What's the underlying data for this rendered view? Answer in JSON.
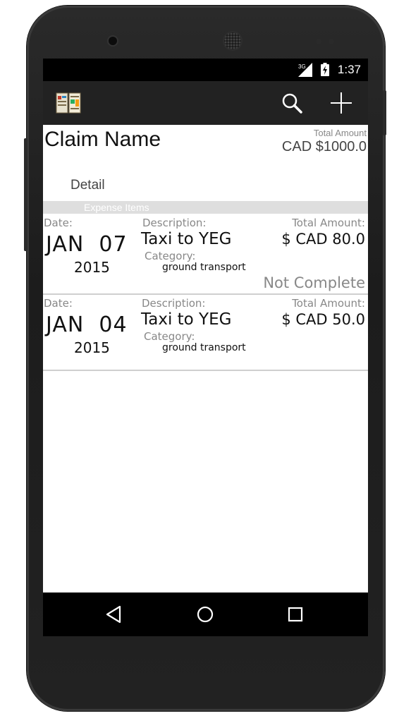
{
  "status_bar": {
    "network": "3G",
    "time": "1:37"
  },
  "claim": {
    "name": "Claim Name",
    "total_label": "Total Amount",
    "total_value": "CAD $1000.0",
    "detail_label": "Detail"
  },
  "section": {
    "header": "Expense Items"
  },
  "items": [
    {
      "date_label": "Date:",
      "month_day": "JAN  07",
      "year": "2015",
      "description_label": "Description:",
      "description": "Taxi to YEG",
      "category_label": "Category:",
      "category": "ground transport",
      "amount_label": "Total Amount:",
      "amount": "$ CAD 80.0",
      "status": "Not Complete"
    },
    {
      "date_label": "Date:",
      "month_day": "JAN  04",
      "year": "2015",
      "description_label": "Description:",
      "description": "Taxi to YEG",
      "category_label": "Category:",
      "category": "ground transport",
      "amount_label": "Total Amount:",
      "amount": "$ CAD 50.0"
    }
  ],
  "icons": {
    "app": "expense-app-icon",
    "search": "search-icon",
    "add": "plus-icon",
    "back": "back-triangle-icon",
    "home": "home-circle-icon",
    "recents": "recents-square-icon"
  }
}
